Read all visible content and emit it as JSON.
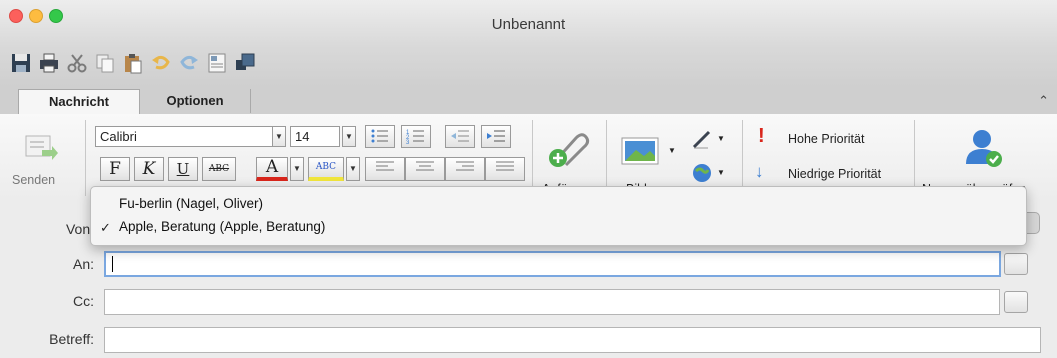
{
  "window": {
    "title": "Unbenannt"
  },
  "quick_access": {
    "icons": [
      "save-icon",
      "print-icon",
      "cut-icon",
      "copy-icon",
      "paste-icon",
      "undo-icon",
      "redo-icon",
      "address-card-icon",
      "window-layout-icon"
    ]
  },
  "tabs": [
    "Nachricht",
    "Optionen"
  ],
  "ribbon": {
    "send_label": "Senden",
    "font_name": "Calibri",
    "font_size": "14",
    "bold": "F",
    "italic": "K",
    "underline": "U",
    "strike": "ABC",
    "font_color": "A",
    "highlight": "ABC",
    "attach_label": "Anfügen",
    "picture_label": "Bild",
    "high_priority": "Hohe Priorität",
    "low_priority": "Niedrige Priorität",
    "check_names": "Namen überprüfen"
  },
  "fields": {
    "from_label": "Von:",
    "to_label": "An:",
    "cc_label": "Cc:",
    "subject_label": "Betreff:",
    "to_value": "",
    "cc_value": "",
    "subject_value": ""
  },
  "account_menu": {
    "items": [
      {
        "label": "Fu-berlin (Nagel, Oliver)",
        "checked": false
      },
      {
        "label": "Apple, Beratung (Apple, Beratung)",
        "checked": true
      }
    ]
  },
  "colors": {
    "accent": "#7aa7e0",
    "priority_high": "#d9261c",
    "priority_low": "#3d7fd1"
  }
}
